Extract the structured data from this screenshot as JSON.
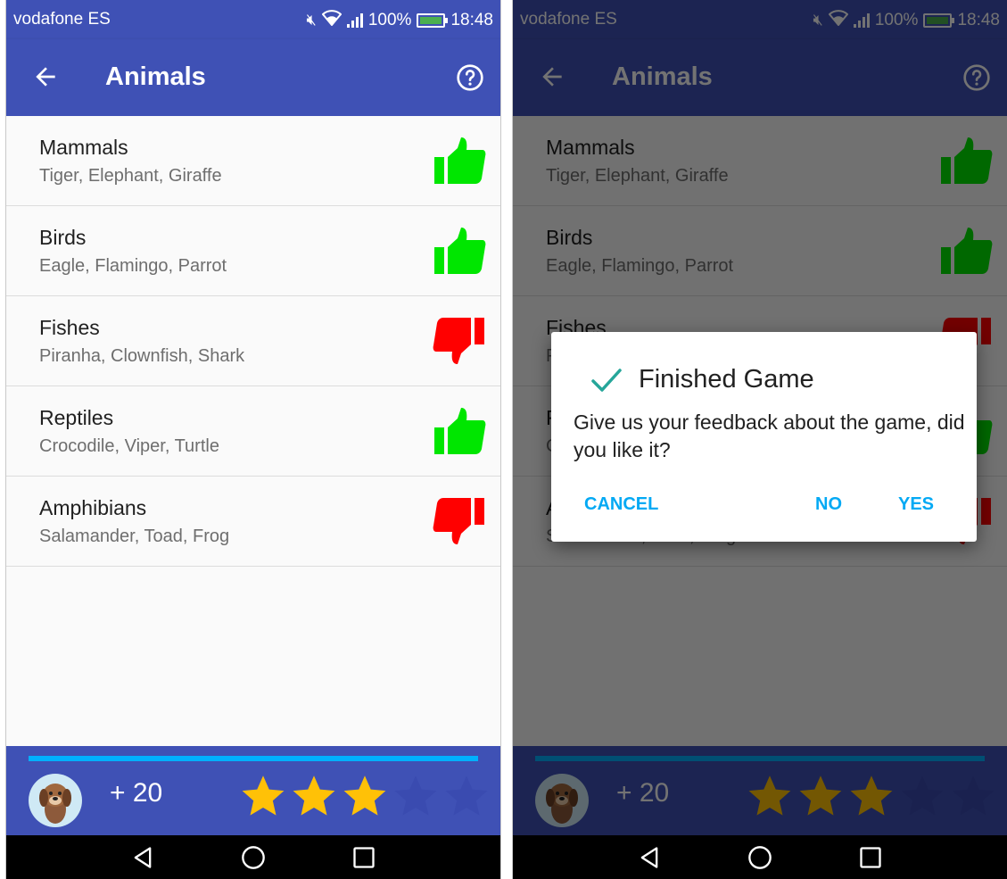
{
  "status": {
    "carrier": "vodafone ES",
    "battery": "100%",
    "time": "18:48"
  },
  "toolbar": {
    "title": "Animals"
  },
  "categories": [
    {
      "name": "Mammals",
      "examples": "Tiger, Elephant, Giraffe",
      "rating": "like"
    },
    {
      "name": "Birds",
      "examples": "Eagle, Flamingo, Parrot",
      "rating": "like"
    },
    {
      "name": "Fishes",
      "examples": "Piranha, Clownfish, Shark",
      "rating": "dislike"
    },
    {
      "name": "Reptiles",
      "examples": "Crocodile, Viper, Turtle",
      "rating": "like"
    },
    {
      "name": "Amphibians",
      "examples": "Salamander, Toad, Frog",
      "rating": "dislike"
    }
  ],
  "footer": {
    "score": "+ 20",
    "stars_filled": 3,
    "stars_total": 5
  },
  "dialog": {
    "title": "Finished Game",
    "message": "Give us your feedback about the game, did you like it?",
    "cancel_label": "CANCEL",
    "no_label": "NO",
    "yes_label": "YES"
  },
  "colors": {
    "primary": "#3f51b5",
    "like": "#00e600",
    "dislike": "#ff0000",
    "accent": "#03a9f4",
    "star": "#ffc107",
    "check": "#26a69a"
  },
  "icons": {
    "back": "arrow-back-icon",
    "help": "help-circle-icon",
    "like": "thumbs-up-icon",
    "dislike": "thumbs-down-icon",
    "check": "check-icon"
  }
}
